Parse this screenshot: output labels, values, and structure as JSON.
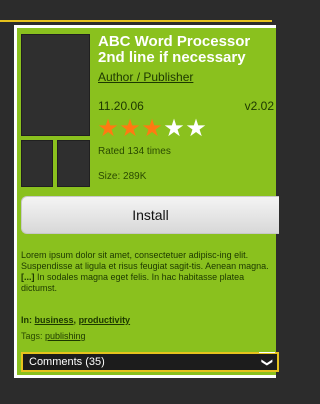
{
  "app": {
    "title": "ABC Word Processor\n2nd line if necessary",
    "author_link": "Author / Publisher",
    "date": "11.20.06",
    "version": "v2.02",
    "rating": {
      "value": 3,
      "max": 5,
      "filled_color": "#ff7a12",
      "empty_color": "#ffffff"
    },
    "rated_text": "Rated 134 times",
    "size_text": "Size: 289K"
  },
  "actions": {
    "install_label": "Install"
  },
  "description": {
    "part1": "Lorem ipsum dolor sit amet, consectetuer adipisc-ing elit. Suspendisse at ligula et risus feugiat sagit-tis. Aenean magna. ",
    "more": "[...]",
    "part2": " In sodales magna eget felis. In hac habitasse platea dictumst."
  },
  "categories": {
    "prefix": "In:",
    "items": [
      "business",
      "productivity"
    ],
    "separator": ","
  },
  "tags": {
    "prefix": "Tags:",
    "items": [
      "publishing"
    ]
  },
  "comments": {
    "label": "Comments (35)",
    "icon": "chevron-down-icon"
  },
  "colors": {
    "card_bg": "#8ac11e",
    "accent": "#e6c21d",
    "page_bg": "#2c2c2c"
  }
}
